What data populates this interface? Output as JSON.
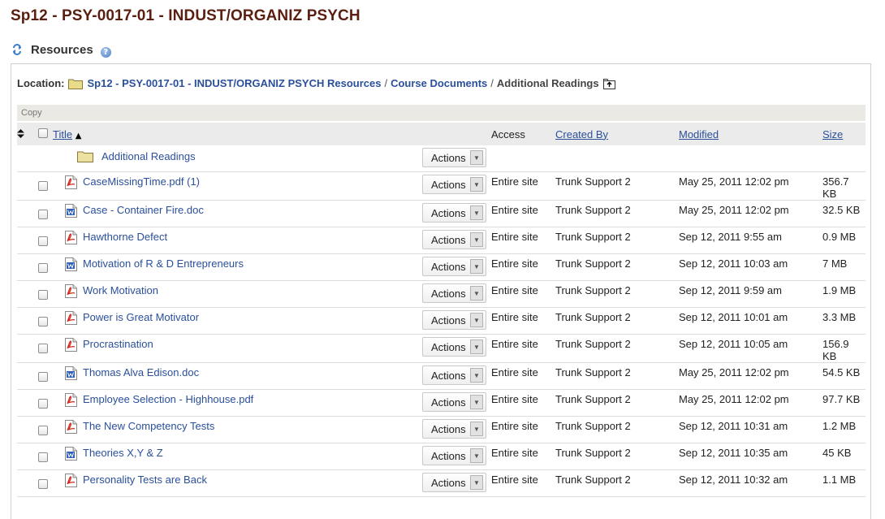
{
  "site_title": "Sp12 - PSY-0017-01 - INDUST/ORGANIZ PSYCH",
  "tool": {
    "title": "Resources",
    "help_glyph": "?"
  },
  "location": {
    "label": "Location:",
    "crumbs": [
      "Sp12 - PSY-0017-01 - INDUST/ORGANIZ PSYCH Resources",
      "Course Documents"
    ],
    "separator": "/",
    "current": "Additional Readings"
  },
  "toolbar": {
    "copy_label": "Copy"
  },
  "columns": {
    "title": "Title",
    "title_sort_glyph": "▲",
    "access": "Access",
    "created_by": "Created By",
    "modified": "Modified",
    "size": "Size"
  },
  "folder": {
    "name": "Additional Readings",
    "actions": "Actions"
  },
  "rows": [
    {
      "type": "pdf",
      "title": "CaseMissingTime.pdf (1)",
      "actions": "Actions",
      "access": "Entire site",
      "created_by": "Trunk Support 2",
      "modified": "May 25, 2011 12:02 pm",
      "size": "356.7 KB"
    },
    {
      "type": "doc",
      "title": "Case - Container Fire.doc",
      "actions": "Actions",
      "access": "Entire site",
      "created_by": "Trunk Support 2",
      "modified": "May 25, 2011 12:02 pm",
      "size": "32.5 KB"
    },
    {
      "type": "pdf",
      "title": "Hawthorne Defect",
      "actions": "Actions",
      "access": "Entire site",
      "created_by": "Trunk Support 2",
      "modified": "Sep 12, 2011 9:55 am",
      "size": "0.9 MB"
    },
    {
      "type": "doc",
      "title": "Motivation of R & D Entrepreneurs",
      "actions": "Actions",
      "access": "Entire site",
      "created_by": "Trunk Support 2",
      "modified": "Sep 12, 2011 10:03 am",
      "size": "7 MB"
    },
    {
      "type": "pdf",
      "title": "Work Motivation",
      "actions": "Actions",
      "access": "Entire site",
      "created_by": "Trunk Support 2",
      "modified": "Sep 12, 2011 9:59 am",
      "size": "1.9 MB"
    },
    {
      "type": "pdf",
      "title": "Power is Great Motivator",
      "actions": "Actions",
      "access": "Entire site",
      "created_by": "Trunk Support 2",
      "modified": "Sep 12, 2011 10:01 am",
      "size": "3.3 MB"
    },
    {
      "type": "pdf",
      "title": "Procrastination",
      "actions": "Actions",
      "access": "Entire site",
      "created_by": "Trunk Support 2",
      "modified": "Sep 12, 2011 10:05 am",
      "size": "156.9 KB"
    },
    {
      "type": "doc",
      "title": "Thomas Alva Edison.doc",
      "actions": "Actions",
      "access": "Entire site",
      "created_by": "Trunk Support 2",
      "modified": "May 25, 2011 12:02 pm",
      "size": "54.5 KB"
    },
    {
      "type": "pdf",
      "title": "Employee Selection - Highhouse.pdf",
      "actions": "Actions",
      "access": "Entire site",
      "created_by": "Trunk Support 2",
      "modified": "May 25, 2011 12:02 pm",
      "size": "97.7 KB"
    },
    {
      "type": "pdf",
      "title": "The New Competency Tests",
      "actions": "Actions",
      "access": "Entire site",
      "created_by": "Trunk Support 2",
      "modified": "Sep 12, 2011 10:31 am",
      "size": "1.2 MB"
    },
    {
      "type": "doc",
      "title": "Theories X,Y & Z",
      "actions": "Actions",
      "access": "Entire site",
      "created_by": "Trunk Support 2",
      "modified": "Sep 12, 2011 10:35 am",
      "size": "45 KB"
    },
    {
      "type": "pdf",
      "title": "Personality Tests are Back",
      "actions": "Actions",
      "access": "Entire site",
      "created_by": "Trunk Support 2",
      "modified": "Sep 12, 2011 10:32 am",
      "size": "1.1 MB"
    }
  ],
  "colors": {
    "title": "#5a1f10",
    "link": "#2a4f9b",
    "header_bg": "#ebebeb",
    "toolbar_bg": "#ebe9e4"
  },
  "icons": {
    "reset": "reset-arrows-icon",
    "help": "help-icon",
    "folder": "folder-icon",
    "up": "up-folder-icon",
    "pdf": "pdf-file-icon",
    "doc": "word-doc-icon"
  }
}
